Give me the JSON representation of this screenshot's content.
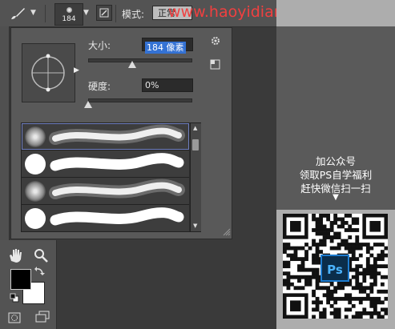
{
  "topbar": {
    "brush_size_number": "184",
    "mode_label": "模式:",
    "mode_value": "正常",
    "watermark": "www.haoyidianjinshe.com"
  },
  "panel": {
    "size_label": "大小:",
    "size_value": "184 像素",
    "size_fraction": 0.43,
    "hardness_label": "硬度:",
    "hardness_value": "0%",
    "hardness_fraction": 0.0,
    "brushes": [
      {
        "tip": "soft",
        "selected": true
      },
      {
        "tip": "hard",
        "selected": false
      },
      {
        "tip": "soft",
        "selected": false
      },
      {
        "tip": "hard",
        "selected": false
      }
    ]
  },
  "promo": {
    "line1": "加公众号",
    "line2": "领取PS自学福利",
    "line3": "赶快微信扫一扫",
    "arrow": "▼",
    "badge": "Ps"
  },
  "colors": {
    "foreground": "#000000",
    "background": "#ffffff",
    "watermark": "#f04040"
  }
}
